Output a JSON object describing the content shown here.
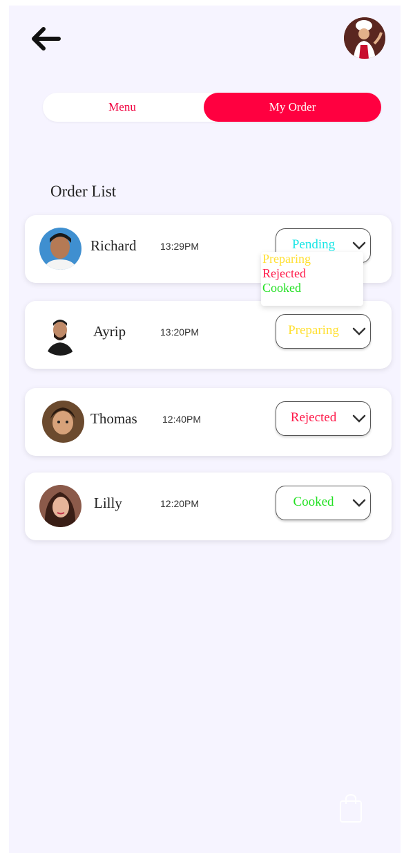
{
  "header": {
    "back_icon": "arrow-left-icon",
    "profile_icon": "chef-avatar-icon"
  },
  "tabs": {
    "menu_label": "Menu",
    "my_order_label": "My Order",
    "active": "My Order"
  },
  "section_title": "Order List",
  "orders": [
    {
      "name": "Richard",
      "time": "13:29PM",
      "status": "Pending",
      "status_color": "#19e6e6"
    },
    {
      "name": "Ayrip",
      "time": "13:20PM",
      "status": "Preparing",
      "status_color": "#ffe033"
    },
    {
      "name": "Thomas",
      "time": "12:40PM",
      "status": "Rejected",
      "status_color": "#ff1a4a"
    },
    {
      "name": "Lilly",
      "time": "12:20PM",
      "status": "Cooked",
      "status_color": "#22e022"
    }
  ],
  "dropdown": {
    "options": [
      {
        "label": "Preparing",
        "color": "#ffe033"
      },
      {
        "label": "Rejected",
        "color": "#ff1a4a"
      },
      {
        "label": "Cooked",
        "color": "#22e022"
      }
    ]
  },
  "colors": {
    "accent": "#ff0040",
    "background": "#f6f4ff"
  },
  "footer": {
    "bag_icon": "shopping-bag-icon"
  }
}
